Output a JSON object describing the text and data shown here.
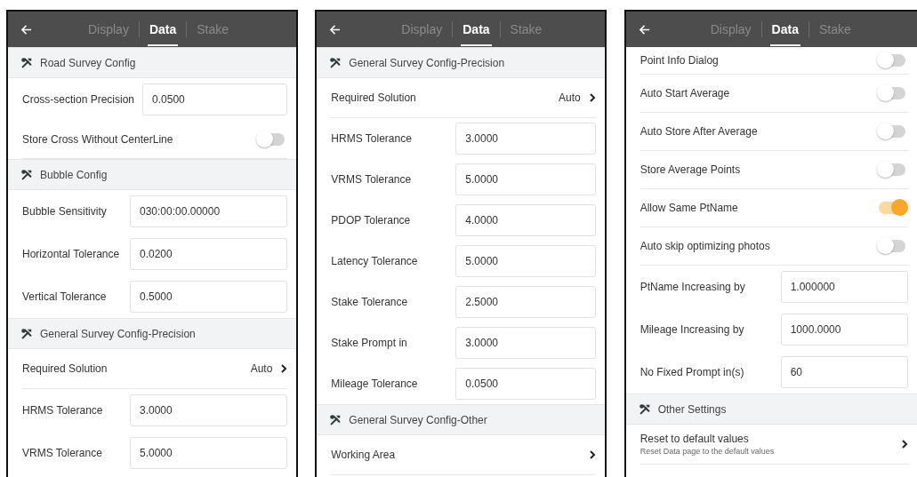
{
  "screens": [
    {
      "tabs": [
        {
          "label": "Display",
          "selected": false
        },
        {
          "label": "Data",
          "selected": true
        },
        {
          "label": "Stake",
          "selected": false
        }
      ],
      "rows": [
        {
          "kind": "section",
          "label": "Road Survey Config"
        },
        {
          "kind": "input",
          "label": "Cross-section Precision",
          "value": "0.0500"
        },
        {
          "kind": "toggle",
          "label": "Store Cross Without CenterLine",
          "on": false
        },
        {
          "kind": "section",
          "label": "Bubble Config"
        },
        {
          "kind": "input",
          "label": "Bubble Sensitivity",
          "value": "030:00:00.00000"
        },
        {
          "kind": "input",
          "label": "Horizontal Tolerance",
          "value": "0.0200"
        },
        {
          "kind": "input",
          "label": "Vertical Tolerance",
          "value": "0.5000"
        },
        {
          "kind": "section",
          "label": "General Survey Config-Precision"
        },
        {
          "kind": "link",
          "label": "Required Solution",
          "value": "Auto"
        },
        {
          "kind": "input",
          "label": "HRMS Tolerance",
          "value": "3.0000"
        },
        {
          "kind": "input",
          "label": "VRMS Tolerance",
          "value": "5.0000"
        }
      ]
    },
    {
      "tabs": [
        {
          "label": "Display",
          "selected": false
        },
        {
          "label": "Data",
          "selected": true
        },
        {
          "label": "Stake",
          "selected": false
        }
      ],
      "rows": [
        {
          "kind": "section",
          "label": "General Survey Config-Precision"
        },
        {
          "kind": "link",
          "label": "Required Solution",
          "value": "Auto"
        },
        {
          "kind": "input",
          "label": "HRMS Tolerance",
          "value": "3.0000"
        },
        {
          "kind": "input",
          "label": "VRMS Tolerance",
          "value": "5.0000"
        },
        {
          "kind": "input",
          "label": "PDOP Tolerance",
          "value": "4.0000"
        },
        {
          "kind": "input",
          "label": "Latency Tolerance",
          "value": "5.0000"
        },
        {
          "kind": "input",
          "label": "Stake Tolerance",
          "value": "2.5000"
        },
        {
          "kind": "input",
          "label": "Stake Prompt in",
          "value": "3.0000"
        },
        {
          "kind": "input",
          "label": "Mileage Tolerance",
          "value": "0.0500"
        },
        {
          "kind": "section",
          "label": "General Survey Config-Other"
        },
        {
          "kind": "link",
          "label": "Working Area"
        }
      ]
    },
    {
      "tabs": [
        {
          "label": "Display",
          "selected": false
        },
        {
          "label": "Data",
          "selected": true
        },
        {
          "label": "Stake",
          "selected": false
        }
      ],
      "rows": [
        {
          "kind": "toggle",
          "label": "Point Info Dialog",
          "on": false
        },
        {
          "kind": "toggle",
          "label": "Auto Start Average",
          "on": false
        },
        {
          "kind": "toggle",
          "label": "Auto Store After Average",
          "on": false
        },
        {
          "kind": "toggle",
          "label": "Store Average Points",
          "on": false
        },
        {
          "kind": "toggle",
          "label": "Allow Same PtName",
          "on": true
        },
        {
          "kind": "toggle",
          "label": "Auto skip optimizing photos",
          "on": false
        },
        {
          "kind": "input",
          "label": "PtName Increasing by",
          "value": "1.000000"
        },
        {
          "kind": "input",
          "label": "Mileage Increasing by",
          "value": "1000.0000"
        },
        {
          "kind": "input",
          "label": "No Fixed Prompt in(s)",
          "value": "60"
        },
        {
          "kind": "section",
          "label": "Other Settings"
        },
        {
          "kind": "link",
          "label": "Reset to default values",
          "description": "Reset Data page to the default values"
        }
      ]
    }
  ]
}
